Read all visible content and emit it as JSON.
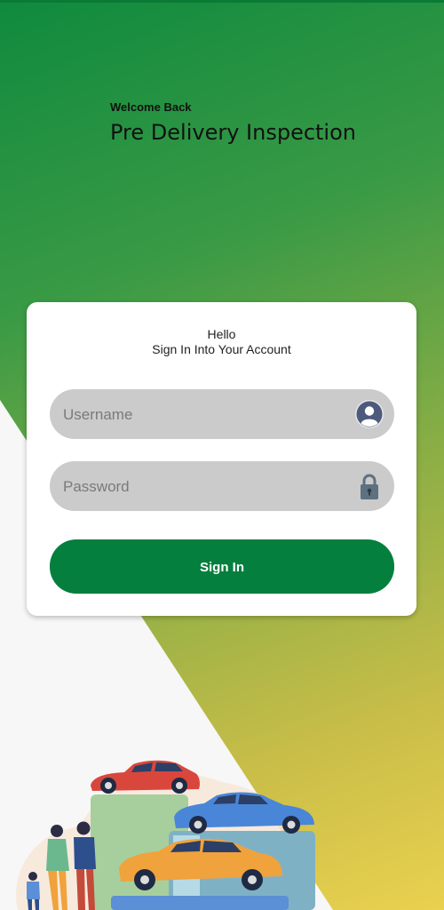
{
  "header": {
    "welcome": "Welcome Back",
    "title": "Pre Delivery Inspection"
  },
  "card": {
    "hello": "Hello",
    "subtitle": "Sign In Into Your Account",
    "username_placeholder": "Username",
    "password_placeholder": "Password",
    "signin_label": "Sign In"
  },
  "icons": {
    "user": "user-avatar-icon",
    "lock": "lock-icon"
  },
  "colors": {
    "brand_green": "#057f3d",
    "gradient_start": "#0f8a3e",
    "gradient_end": "#ead14f",
    "field_bg": "#cbcbcb"
  }
}
